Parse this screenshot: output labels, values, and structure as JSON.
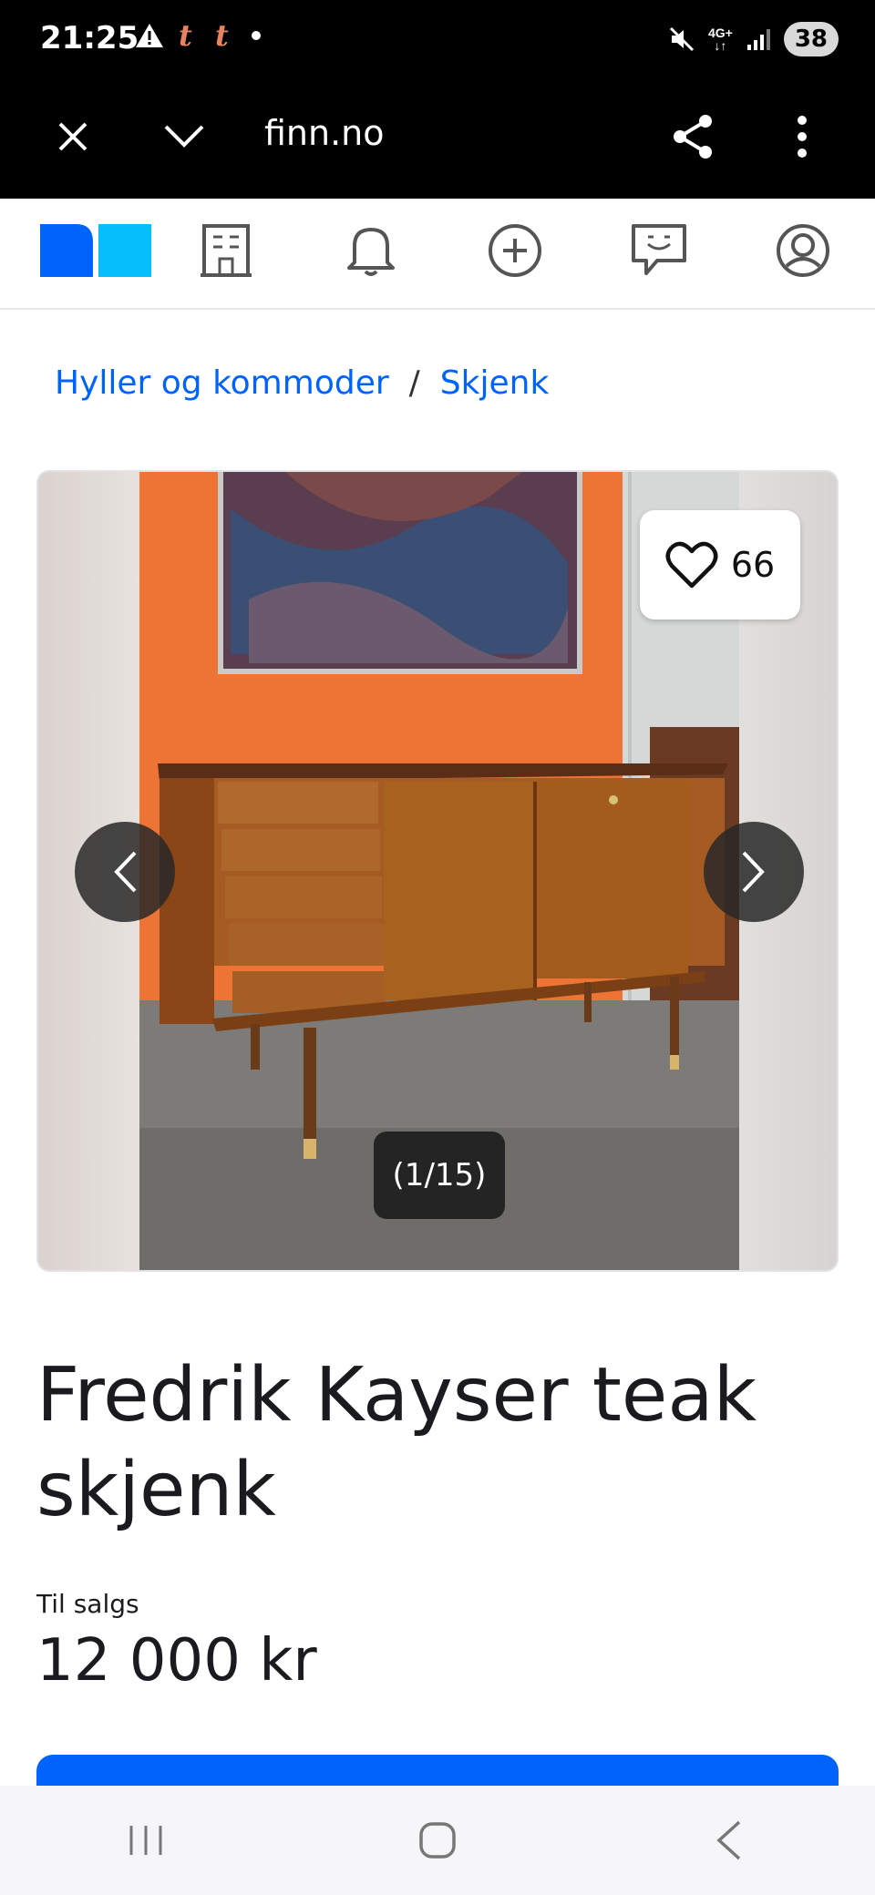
{
  "status_bar": {
    "time": "21:25",
    "network_top": "4G+",
    "network_bottom": "↓↑",
    "battery": "38"
  },
  "browser": {
    "url": "finn.no",
    "icons": [
      "close-icon",
      "chevron-down-icon",
      "share-icon",
      "more-vert-icon"
    ]
  },
  "app_nav": {
    "icons": [
      "finn-logo",
      "building-icon",
      "bell-icon",
      "add-circle-icon",
      "messages-icon",
      "profile-icon"
    ],
    "accent": "#0063fb",
    "logo_light": "#06befb"
  },
  "breadcrumb": {
    "items": [
      "Hyller og kommoder",
      "Skjenk"
    ],
    "separator": "/"
  },
  "gallery": {
    "favorite_count": "66",
    "counter": "(1/15)"
  },
  "listing": {
    "title": "Fredrik Kayser teak skjenk",
    "sale_label": "Til salgs",
    "price": "12 000 kr"
  }
}
